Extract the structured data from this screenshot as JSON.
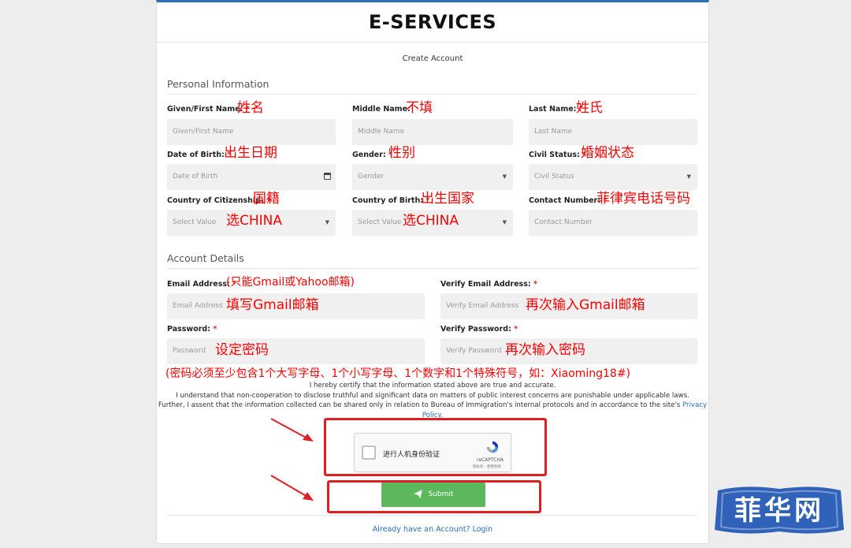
{
  "header": {
    "title": "E-SERVICES",
    "subtitle": "Create Account"
  },
  "personal": {
    "section_title": "Personal Information",
    "first_name": {
      "label": "Given/First Name:",
      "req": "*",
      "placeholder": "Given/First Name",
      "note": "姓名"
    },
    "middle_name": {
      "label": "Middle Name:",
      "placeholder": "Middle Name",
      "note": "不填"
    },
    "last_name": {
      "label": "Last Name:",
      "req": "*",
      "placeholder": "Last Name",
      "note": "姓氏"
    },
    "dob": {
      "label": "Date of Birth:",
      "req": "*",
      "placeholder": "Date of Birth",
      "note": "出生日期"
    },
    "gender": {
      "label": "Gender:",
      "req": "*",
      "placeholder": "Gender",
      "note": "性别"
    },
    "civil": {
      "label": "Civil Status:",
      "req": "*",
      "placeholder": "Civil Status",
      "note": "婚姻状态"
    },
    "citizenship": {
      "label": "Country of Citizenship:",
      "req": "*",
      "placeholder": "Select Value",
      "note": "国籍",
      "select_note": "选CHINA"
    },
    "birth_country": {
      "label": "Country of Birth:",
      "req": "*",
      "placeholder": "Select Value",
      "note": "出生国家",
      "select_note": "选CHINA"
    },
    "contact": {
      "label": "Contact Number:",
      "req": "*",
      "placeholder": "Contact Number",
      "note": "菲律宾电话号码"
    }
  },
  "account": {
    "section_title": "Account Details",
    "email": {
      "label": "Email Address:",
      "req": "*",
      "placeholder": "Email Address",
      "note": "(只能Gmail或Yahoo邮箱)",
      "field_note": "填写Gmail邮箱"
    },
    "verify_email": {
      "label": "Verify Email Address:",
      "req": "*",
      "placeholder": "Verify Email Address",
      "field_note": "再次输入Gmail邮箱"
    },
    "password": {
      "label": "Password:",
      "req": "*",
      "placeholder": "Password",
      "field_note": "设定密码"
    },
    "verify_password": {
      "label": "Verify Password:",
      "req": "*",
      "placeholder": "Verify Password",
      "field_note": "再次输入密码"
    },
    "password_rule": "(密码必须至少包含1个大写字母、1个小写字母、1个数字和1个特殊符号，如：Xiaoming18#)"
  },
  "certify": {
    "line1": "I hereby certify that the information stated above are true and accurate.",
    "line2": "I understand that non-cooperation to disclose truthful and significant data on matters of public interest concerns are punishable under applicable laws.",
    "line3": "Further, I assent that the information collected can be shared only in relation to Bureau of Immigration's internal protocols and in accordance to the site's",
    "link": "Privacy Policy."
  },
  "captcha": {
    "label": "进行人机身份验证",
    "brand": "reCAPTCHA",
    "terms": "隐私权 - 使用条款"
  },
  "submit_label": "Submit",
  "login_link": "Already have an Account? Login",
  "watermark": "菲华网",
  "colors": {
    "accent": "#2d6fb7",
    "submit": "#5cb85c",
    "annotation": "#ff0000",
    "link": "#2a6ebb"
  }
}
